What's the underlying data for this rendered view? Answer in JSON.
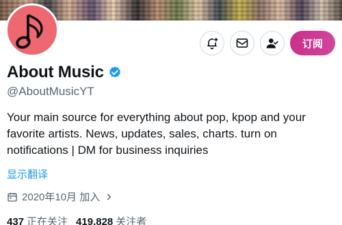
{
  "profile": {
    "display_name": "About Music",
    "handle": "@AboutMusicYT",
    "bio": "Your main source for everything about pop, kpop and your favorite artists. News, updates, sales, charts. turn on notifications | DM for business inquiries",
    "translate_label": "显示翻译",
    "joined_label": "2020年10月 加入",
    "verified_badge_color": "#1d9bf0",
    "avatar_color": "#ee6872"
  },
  "actions": {
    "subscribe_label": "订阅",
    "icons": [
      "bell-plus-icon",
      "mail-icon",
      "user-check-icon"
    ],
    "subscribe_color": "#c9308a"
  },
  "stats": {
    "following_count": "437",
    "following_label": "正在关注",
    "followers_count": "419,828",
    "followers_label": "关注者"
  }
}
